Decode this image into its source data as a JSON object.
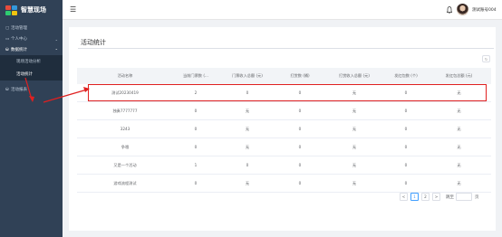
{
  "app": {
    "logo_text": "智慧现场"
  },
  "sidebar": {
    "items": [
      {
        "icon": "▢",
        "label": "活动管理"
      },
      {
        "icon": "▭",
        "label": "个人中心",
        "chev": "⌄"
      },
      {
        "icon": "⛁",
        "label": "数据统计",
        "chev": "⌃"
      }
    ],
    "sub_items": [
      {
        "label": "现场活动分析"
      },
      {
        "label": "活动统计"
      }
    ],
    "bottom_item": {
      "icon": "⛁",
      "label": "活动报表"
    }
  },
  "topbar": {
    "menu_icon": "☰",
    "username": "测试账号004"
  },
  "page": {
    "title": "活动统计",
    "refresh_icon": "↻"
  },
  "table": {
    "headers": [
      "活动名称",
      "当前门票数 (...",
      "门票收入总额 (元)",
      "打赏数 (桶)",
      "打赏收入总额 (元)",
      "发红包数 (个)",
      "发红包总额 (元)"
    ],
    "rows": [
      [
        "测试20230419",
        "2",
        "0",
        "0",
        "无",
        "0",
        "无"
      ],
      [
        "独奏7777777",
        "0",
        "无",
        "0",
        "无",
        "0",
        "无"
      ],
      [
        "3243",
        "0",
        "无",
        "0",
        "无",
        "0",
        "无"
      ],
      [
        "争哦",
        "0",
        "无",
        "0",
        "无",
        "0",
        "无"
      ],
      [
        "又是一个活动",
        "1",
        "0",
        "0",
        "无",
        "0",
        "无"
      ],
      [
        "游戏流程测试",
        "0",
        "无",
        "0",
        "无",
        "0",
        "无"
      ]
    ]
  },
  "pagination": {
    "prev": "<",
    "pages": [
      "1",
      "2"
    ],
    "next": ">",
    "goto_label": "跳至",
    "page_unit": "页"
  },
  "colors": {
    "sidebar_bg": "#304156",
    "accent": "#409eff",
    "highlight": "#e02020"
  }
}
